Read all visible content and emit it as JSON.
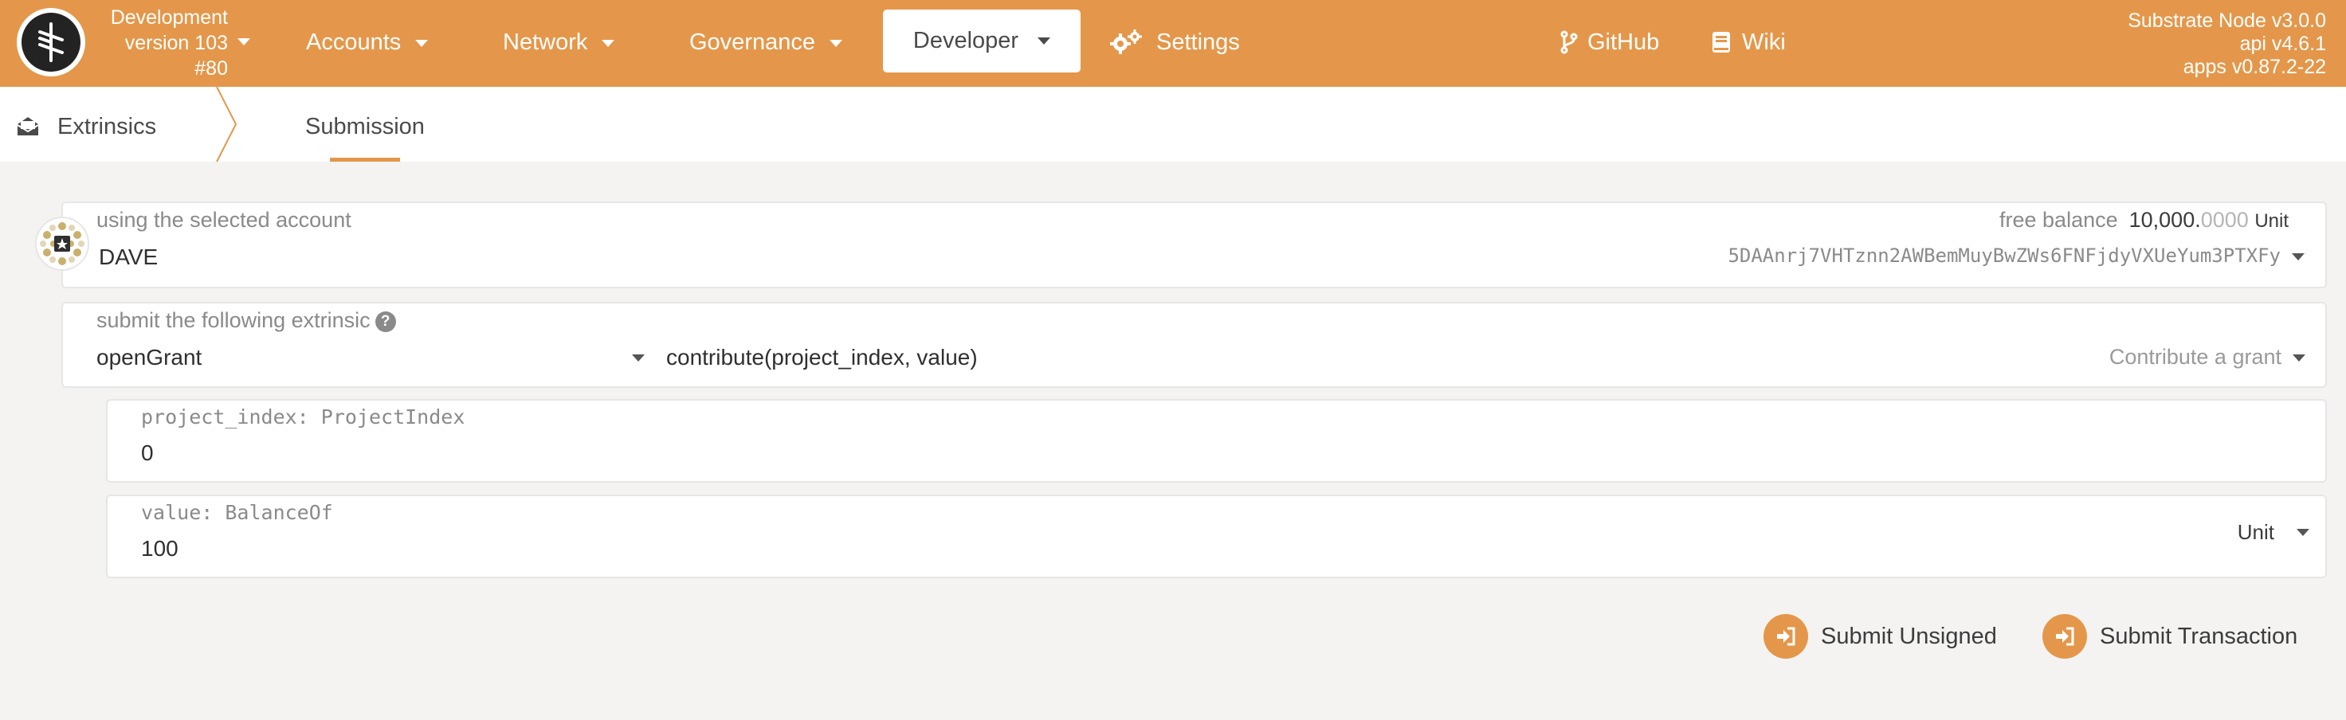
{
  "header": {
    "chain_name": "Development",
    "version": "version 103",
    "block": "#80",
    "nav": [
      {
        "label": "Accounts"
      },
      {
        "label": "Network"
      },
      {
        "label": "Governance"
      },
      {
        "label": "Developer"
      },
      {
        "label": "Settings"
      }
    ],
    "links": [
      {
        "label": "GitHub"
      },
      {
        "label": "Wiki"
      }
    ],
    "node_version": "Substrate Node v3.0.0",
    "api_version": "api v4.6.1",
    "apps_version": "apps v0.87.2-22"
  },
  "subnav": {
    "tabs": [
      {
        "label": "Extrinsics"
      },
      {
        "label": "Submission"
      }
    ],
    "active_tab": "Submission"
  },
  "account": {
    "label": "using the selected account",
    "name": "DAVE",
    "free_balance_label": "free balance",
    "balance_int": "10,000.",
    "balance_dec": "0000",
    "balance_unit": "Unit",
    "address": "5DAAnrj7VHTznn2AWBemMuyBwZWs6FNFjdyVXUeYum3PTXFy"
  },
  "extrinsic": {
    "label": "submit the following extrinsic",
    "help_glyph": "?",
    "section": "openGrant",
    "method": "contribute(project_index, value)",
    "description": "Contribute a grant"
  },
  "params": [
    {
      "label": "project_index: ProjectIndex",
      "value": "0"
    },
    {
      "label": "value: BalanceOf",
      "value": "100",
      "unit": "Unit"
    }
  ],
  "actions": {
    "submit_unsigned": "Submit Unsigned",
    "submit_transaction": "Submit Transaction"
  },
  "colors": {
    "brand": "#e4974a",
    "background": "#f4f3f2"
  }
}
